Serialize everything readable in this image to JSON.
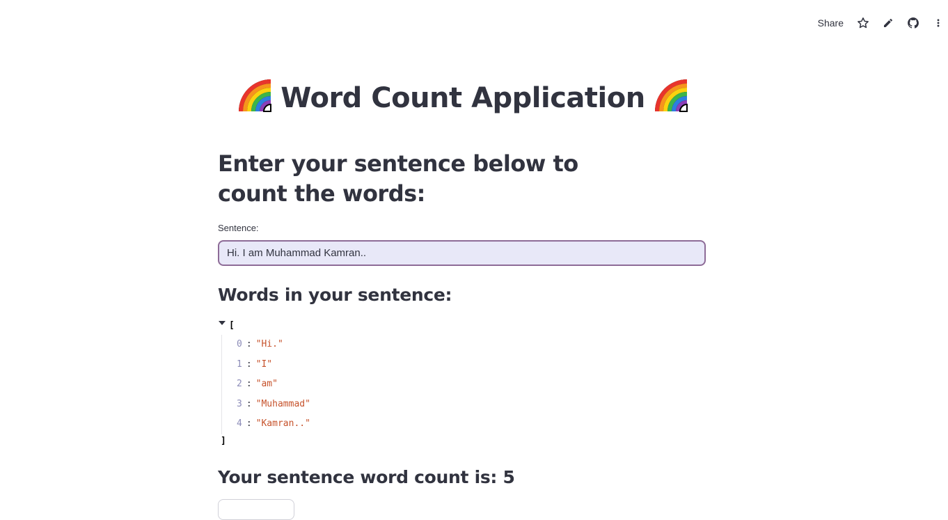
{
  "toolbar": {
    "share_label": "Share",
    "icons": [
      "star-icon",
      "pencil-icon",
      "github-icon",
      "more-vertical-icon"
    ]
  },
  "title": {
    "text": "Word Count Application",
    "emoji": "rainbow"
  },
  "subheader": "Enter your sentence below to count the words:",
  "input": {
    "label": "Sentence:",
    "value": "Hi. I am Muhammad Kamran.."
  },
  "words_heading": "Words in your sentence:",
  "words": {
    "open_bracket": "[",
    "close_bracket": "]",
    "items": [
      {
        "index": "0",
        "value": "\"Hi.\""
      },
      {
        "index": "1",
        "value": "\"I\""
      },
      {
        "index": "2",
        "value": "\"am\""
      },
      {
        "index": "3",
        "value": "\"Muhammad\""
      },
      {
        "index": "4",
        "value": "\"Kamran..\""
      }
    ]
  },
  "count_heading": "Your sentence word count is: 5",
  "colors": {
    "text": "#31333f",
    "input_bg": "#e8e8f8",
    "input_border": "#8d6b97",
    "json_index": "#8c8cb8",
    "json_string": "#c6522b"
  }
}
